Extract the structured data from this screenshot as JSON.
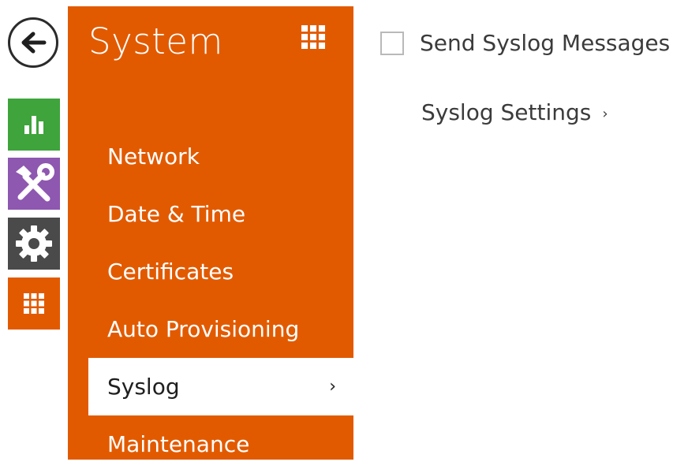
{
  "colors": {
    "accent": "#e25a00",
    "status_tile": "#3ea43b",
    "services_tile": "#8e57b0",
    "hardware_tile": "#4a4a4a",
    "system_tile": "#e25a00"
  },
  "rail": {
    "icons": [
      "back-arrow-icon",
      "bar-chart-icon",
      "tools-icon",
      "gear-icon",
      "grid-icon"
    ]
  },
  "panel": {
    "title": "System",
    "menu": [
      {
        "label": "Network"
      },
      {
        "label": "Date & Time"
      },
      {
        "label": "Certificates"
      },
      {
        "label": "Auto Provisioning"
      },
      {
        "label": "Syslog",
        "active": true,
        "chevron": "›"
      },
      {
        "label": "Maintenance"
      }
    ]
  },
  "content": {
    "send_syslog_label": "Send Syslog Messages",
    "send_syslog_checked": false,
    "syslog_settings_label": "Syslog Settings",
    "syslog_settings_chevron": "›"
  }
}
